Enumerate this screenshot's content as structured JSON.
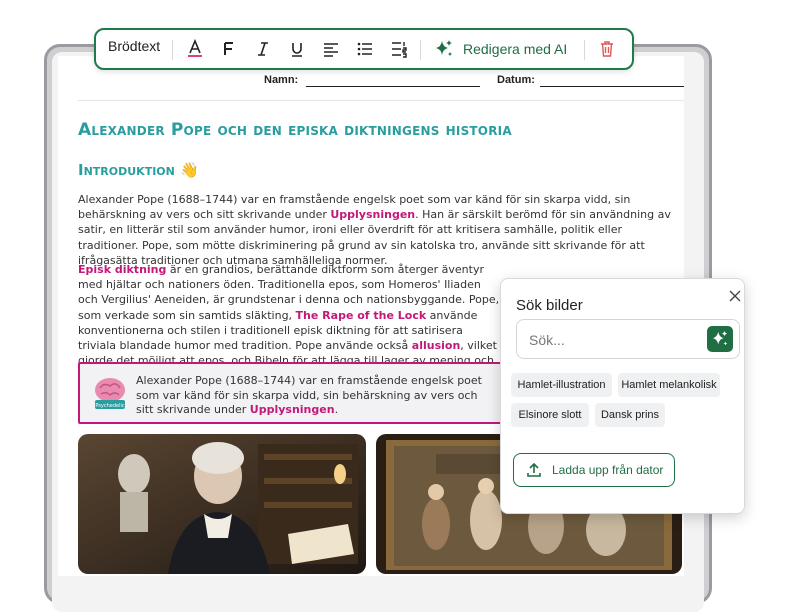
{
  "toolbar": {
    "text_style": "Brödtext",
    "ai_label": "Redigera med AI",
    "icons": [
      "text-color-icon",
      "bold-icon",
      "italic-icon",
      "underline-icon",
      "align-left-icon",
      "bullet-list-icon",
      "numbered-list-icon",
      "sparkle-icon",
      "trash-icon"
    ],
    "accent_color": "#1f6e44",
    "text_color_underline": "#e0407a",
    "trash_color": "#e05555"
  },
  "form": {
    "name_label": "Namn:",
    "date_label": "Datum:"
  },
  "document": {
    "title": "Alexander Pope och den episka diktningens historia",
    "intro_heading": "Introduktion",
    "intro_emoji": "👋",
    "para1": {
      "a": "Alexander Pope (1688–1744) var en framstående engelsk poet som var känd för sin skarpa vidd, sin behärskning av vers och sitt skrivande under ",
      "hl1": "Upplysningen",
      "b": ". Han är särskilt berömd för sin användning av satir, en litterär stil som använder humor, ironi eller överdrift för att kritisera samhälle, politik eller traditioner. Pope, som mötte diskriminering på grund av sin katolska tro, använde sitt skrivande för att ifrågasätta traditioner och utmana samhälleliga normer."
    },
    "para2": {
      "hl1": "Episk diktning",
      "a": " är en grandios, berättande diktform som återger äventyr med hjältar och nationers öden. Traditionella epos, som Homeros' Iliaden och Vergilius' Aeneiden, är grundstenar i denna och nationsbyggande. Pope, som verkade som sin samtids släkting, ",
      "hl2": "The Rape of the Lock",
      "b": " använde konventionerna och stilen i traditionell episk diktning för att satirisera triviala blandade humor med tradition. Pope använde också ",
      "hl3": "allusion",
      "c": ", vilket gjorde det möjligt att epos, och Bibeln för att lägga till lager av mening och knyta an till hans verk."
    },
    "callout": {
      "a": "Alexander Pope (1688–1744) var en framstående engelsk poet som var känd för sin skarpa vidd, sin behärskning av vers och sitt skrivande under ",
      "hl": "Upplysningen",
      "b": ".",
      "badge_label": "Psychedelic"
    },
    "heading_color": "#2a9d9f",
    "highlight_color": "#c2187a"
  },
  "image_search": {
    "title": "Sök bilder",
    "placeholder": "Sök...",
    "value": "",
    "suggestions": [
      "Hamlet-illustration",
      "Hamlet melankolisk",
      "Elsinore slott",
      "Dansk prins"
    ],
    "upload_label": "Ladda upp från dator"
  }
}
